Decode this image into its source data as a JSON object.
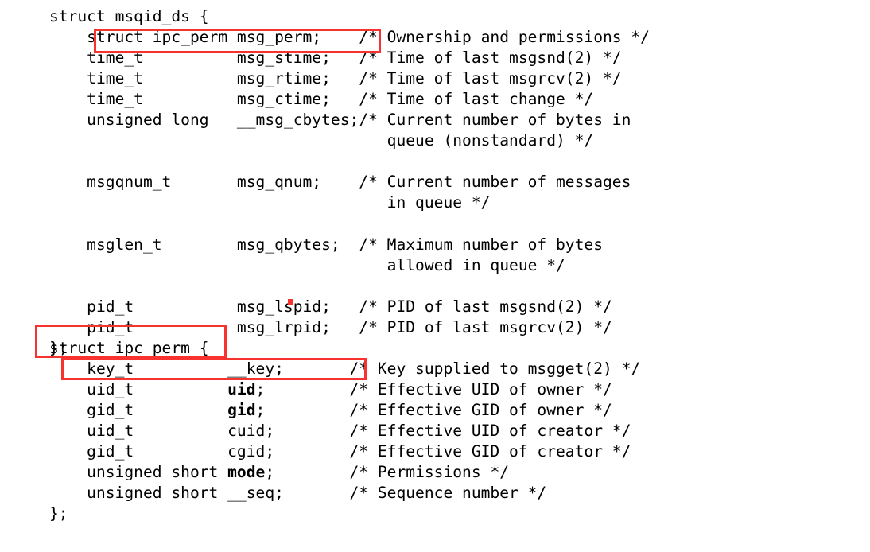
{
  "document": {
    "kind": "code-listing",
    "language": "c",
    "background_color": "#ffffff",
    "text_color": "#000000",
    "annotation_color": "#f8332f"
  },
  "code": {
    "struct_msqid_ds": {
      "header": "struct msqid_ds {",
      "closer": "};",
      "members": [
        {
          "type": "struct ipc_perm",
          "name": "msg_perm;",
          "comment": "/* Ownership and permissions */"
        },
        {
          "type": "time_t",
          "name": "msg_stime;",
          "comment": "/* Time of last msgsnd(2) */"
        },
        {
          "type": "time_t",
          "name": "msg_rtime;",
          "comment": "/* Time of last msgrcv(2) */"
        },
        {
          "type": "time_t",
          "name": "msg_ctime;",
          "comment": "/* Time of last change */"
        },
        {
          "type": "unsigned long",
          "name": "__msg_cbytes;",
          "comment": "/* Current number of bytes in",
          "comment_cont": "queue (nonstandard) */"
        },
        {
          "type": "msgqnum_t",
          "name": "msg_qnum;",
          "comment": "/* Current number of messages",
          "comment_cont": "in queue */"
        },
        {
          "type": "msglen_t",
          "name": "msg_qbytes;",
          "comment": "/* Maximum number of bytes",
          "comment_cont": "allowed in queue */"
        },
        {
          "type": "pid_t",
          "name": "msg_lspid;",
          "comment": "/* PID of last msgsnd(2) */"
        },
        {
          "type": "pid_t",
          "name": "msg_lrpid;",
          "comment": "/* PID of last msgrcv(2) */"
        }
      ]
    },
    "struct_ipc_perm": {
      "header": "struct ipc_perm {",
      "closer": "};",
      "members": [
        {
          "type": "key_t",
          "name": "__key;",
          "bold_name": false,
          "comment": "/* Key supplied to msgget(2) */"
        },
        {
          "type": "uid_t",
          "name": "uid",
          "bold_name": true,
          "terminator": ";",
          "comment": "/* Effective UID of owner */"
        },
        {
          "type": "gid_t",
          "name": "gid",
          "bold_name": true,
          "terminator": ";",
          "comment": "/* Effective GID of owner */"
        },
        {
          "type": "uid_t",
          "name": "cuid;",
          "bold_name": false,
          "comment": "/* Effective UID of creator */"
        },
        {
          "type": "gid_t",
          "name": "cgid;",
          "bold_name": false,
          "comment": "/* Effective GID of creator */"
        },
        {
          "type": "unsigned short",
          "name": "mode",
          "bold_name": true,
          "terminator": ";",
          "comment": "/* Permissions */"
        },
        {
          "type": "unsigned short",
          "name": "__seq;",
          "bold_name": false,
          "comment": "/* Sequence number */"
        }
      ]
    },
    "rendered_block_1": "struct msqid_ds {\n    struct ipc_perm msg_perm;    /* Ownership and permissions */\n    time_t          msg_stime;   /* Time of last msgsnd(2) */\n    time_t          msg_rtime;   /* Time of last msgrcv(2) */\n    time_t          msg_ctime;   /* Time of last change */\n    unsigned long   __msg_cbytes; /* Current number of bytes in\n                                    queue (nonstandard) */\n    msgqnum_t       msg_qnum;    /* Current number of messages\n                                    in queue */\n    msglen_t        msg_qbytes;  /* Maximum number of bytes\n                                    allowed in queue */\n    pid_t           msg_lspid;   /* PID of last msgsnd(2) */\n    pid_t           msg_lrpid;   /* PID of last msgrcv(2) */\n};",
    "rendered_block_2": "struct ipc_perm {\n    key_t          __key;       /* Key supplied to msgget(2) */\n    uid_t          uid;         /* Effective UID of owner */\n    gid_t          gid;         /* Effective GID of owner */\n    uid_t          cuid;        /* Effective UID of creator */\n    gid_t          cgid;        /* Effective GID of creator */\n    unsigned short mode;        /* Permissions */\n    unsigned short __seq;       /* Sequence number */\n};"
  },
  "annotations": [
    {
      "id": "highlight-msg-perm-member",
      "target_text": "struct ipc_perm msg_perm;",
      "shape": "rectangle",
      "color": "#f8332f"
    },
    {
      "id": "highlight-struct-ipc-perm-header",
      "target_text": "struct ipc_perm",
      "shape": "rectangle",
      "color": "#f8332f"
    },
    {
      "id": "highlight-key-member",
      "target_text": "key_t  __key;",
      "shape": "rectangle",
      "color": "#f8332f"
    },
    {
      "id": "stray-mark",
      "target_text": "",
      "shape": "dot",
      "color": "#f8332f"
    }
  ]
}
